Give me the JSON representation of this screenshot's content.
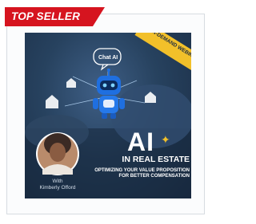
{
  "ribbon": {
    "label": "TOP SELLER"
  },
  "product": {
    "badge": "ON-DEMAND WEBINAR",
    "bubble": "Chat AI",
    "title_main": "AI",
    "title_sub": "IN REAL ESTATE",
    "subtitle": "OPTIMIZING YOUR VALUE PROPOSITION FOR BETTER COMPENSATION",
    "presenter_prefix": "With",
    "presenter_name": "Kimberly Offord"
  },
  "colors": {
    "ribbon": "#d6141f",
    "badge": "#f2c02a",
    "thumb_bg": "#27425f",
    "robot": "#1f6fe0"
  }
}
